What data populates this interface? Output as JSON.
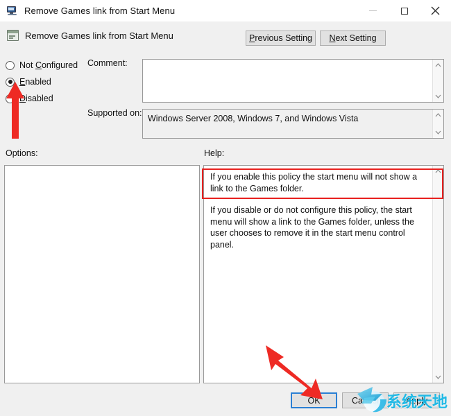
{
  "window": {
    "title": "Remove Games link from Start Menu",
    "title_icon": "computer-monitor-icon",
    "controls": {
      "minimize": "minimize-icon",
      "maximize": "maximize-icon",
      "close": "close-icon"
    }
  },
  "header": {
    "icon": "policy-setting-icon",
    "title": "Remove Games link from Start Menu",
    "previous_setting": "Previous Setting",
    "previous_setting_accel": "P",
    "next_setting": "Next Setting",
    "next_setting_accel": "N"
  },
  "state_options": [
    {
      "label": "Not Configured",
      "accel": "C",
      "pre": "Not ",
      "post": "onfigured",
      "selected": false
    },
    {
      "label": "Enabled",
      "accel": "E",
      "pre": "",
      "post": "nabled",
      "selected": true
    },
    {
      "label": "Disabled",
      "accel": "D",
      "pre": "",
      "post": "isabled",
      "selected": false
    }
  ],
  "comment": {
    "label": "Comment:",
    "value": "",
    "placeholder": ""
  },
  "supported": {
    "label": "Supported on:",
    "value": "Windows Server 2008, Windows 7, and Windows Vista"
  },
  "options": {
    "label": "Options:",
    "items": []
  },
  "help": {
    "label": "Help:",
    "paragraphs": [
      "If you enable this policy the start menu will not show a link to the Games folder.",
      "If you disable or do not configure this policy, the start menu will show a link to the Games folder, unless the user chooses to remove it in the start menu control panel."
    ]
  },
  "footer": {
    "ok": "OK",
    "cancel": "Cancel",
    "apply": "Apply"
  },
  "annotations": {
    "highlight_color": "#e8201e",
    "arrow_color": "#ee2a24",
    "focus_color": "#2a7fd4",
    "arrow_radio_target": "Enabled",
    "arrow_ok_target": "OK",
    "rect_help_target": "first help paragraph"
  },
  "watermark": {
    "text": "系统天地",
    "color": "#11b6e6",
    "logo": "swirl-arrow-logo"
  }
}
